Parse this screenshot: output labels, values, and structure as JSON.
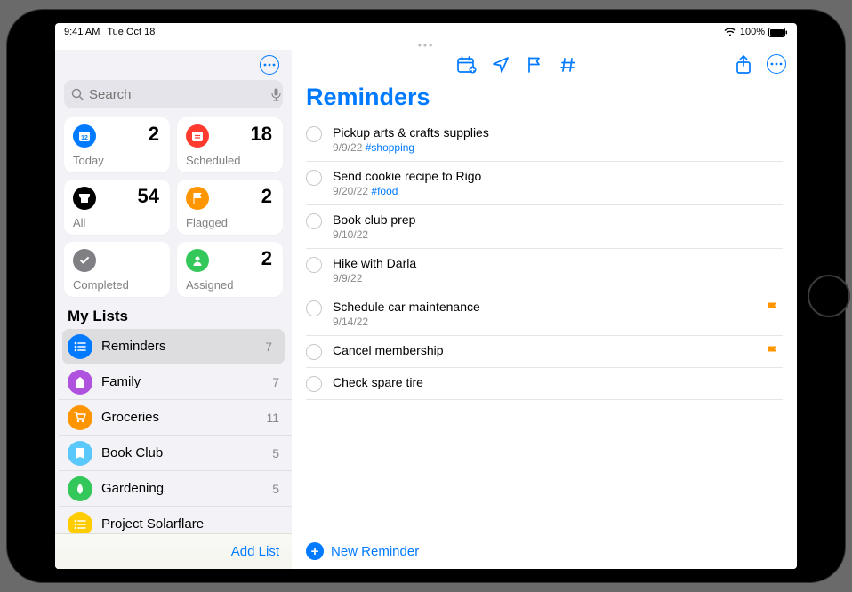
{
  "status": {
    "time": "9:41 AM",
    "date": "Tue Oct 18",
    "battery": "100%"
  },
  "search": {
    "placeholder": "Search"
  },
  "smart_lists": [
    {
      "key": "today",
      "label": "Today",
      "count": "2",
      "bg": "#007aff"
    },
    {
      "key": "scheduled",
      "label": "Scheduled",
      "count": "18",
      "bg": "#ff3b30"
    },
    {
      "key": "all",
      "label": "All",
      "count": "54",
      "bg": "#000000"
    },
    {
      "key": "flagged",
      "label": "Flagged",
      "count": "2",
      "bg": "#ff9500"
    },
    {
      "key": "completed",
      "label": "Completed",
      "count": "",
      "bg": "#808084"
    },
    {
      "key": "assigned",
      "label": "Assigned",
      "count": "2",
      "bg": "#34c759"
    }
  ],
  "my_lists_title": "My Lists",
  "my_lists": [
    {
      "name": "Reminders",
      "count": "7",
      "color": "#007aff",
      "selected": true
    },
    {
      "name": "Family",
      "count": "7",
      "color": "#af52de",
      "selected": false
    },
    {
      "name": "Groceries",
      "count": "11",
      "color": "#ff9500",
      "selected": false
    },
    {
      "name": "Book Club",
      "count": "5",
      "color": "#5ac8fa",
      "selected": false
    },
    {
      "name": "Gardening",
      "count": "5",
      "color": "#34c759",
      "selected": false
    },
    {
      "name": "Project Solarflare",
      "count": "",
      "color": "#ffcc00",
      "selected": false
    }
  ],
  "add_list_label": "Add List",
  "main_title": "Reminders",
  "reminders": [
    {
      "title": "Pickup arts & crafts supplies",
      "date": "9/9/22",
      "tag": "#shopping",
      "flagged": false
    },
    {
      "title": "Send cookie recipe to Rigo",
      "date": "9/20/22",
      "tag": "#food",
      "flagged": false
    },
    {
      "title": "Book club prep",
      "date": "9/10/22",
      "tag": "",
      "flagged": false
    },
    {
      "title": "Hike with Darla",
      "date": "9/9/22",
      "tag": "",
      "flagged": false
    },
    {
      "title": "Schedule car maintenance",
      "date": "9/14/22",
      "tag": "",
      "flagged": true
    },
    {
      "title": "Cancel membership",
      "date": "",
      "tag": "",
      "flagged": true
    },
    {
      "title": "Check spare tire",
      "date": "",
      "tag": "",
      "flagged": false
    }
  ],
  "new_reminder_label": "New Reminder",
  "icons": {
    "today": "calendar-icon",
    "scheduled": "calendar-icon",
    "all": "tray-icon",
    "flagged": "flag-icon",
    "completed": "check-icon",
    "assigned": "person-icon"
  }
}
